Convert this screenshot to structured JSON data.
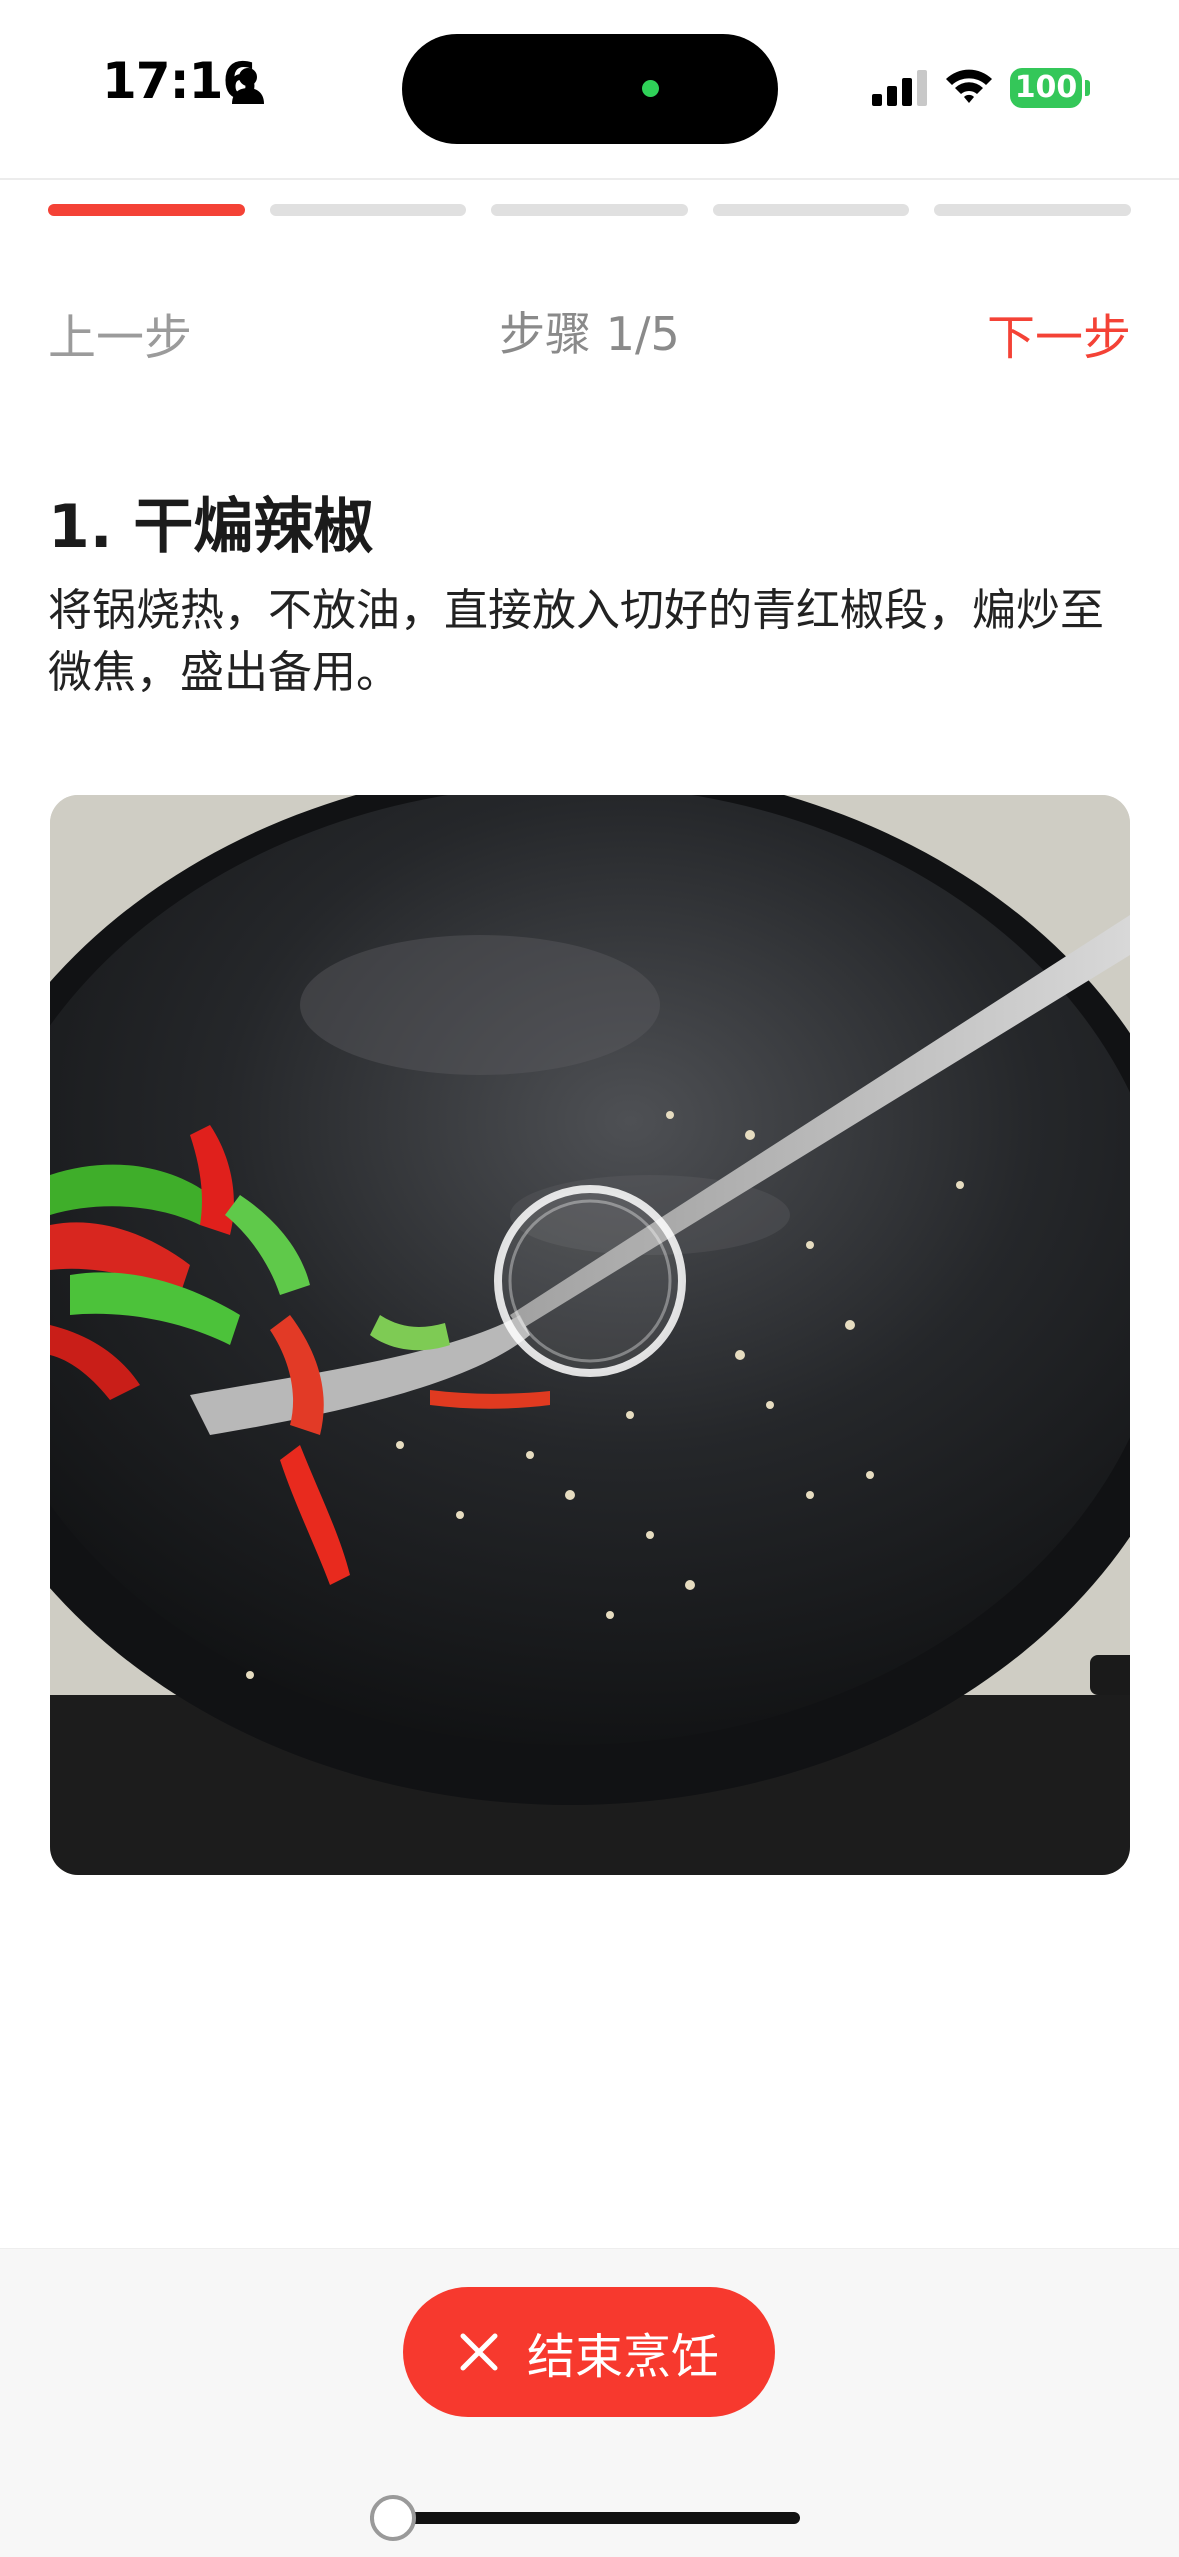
{
  "status_bar": {
    "time": "17:16",
    "battery": "100"
  },
  "progress": {
    "current": 1,
    "total": 5
  },
  "nav": {
    "prev_label": "上一步",
    "step_indicator": "步骤 1/5",
    "next_label": "下一步"
  },
  "step": {
    "title": "1. 干煸辣椒",
    "description": "将锅烧热，不放油，直接放入切好的青红椒段，煸炒至微焦，盛出备用。"
  },
  "actions": {
    "end_label": "结束烹饪"
  },
  "colors": {
    "accent": "#f44236",
    "button": "#f7392e",
    "inactive_segment": "#e0e0e0"
  },
  "icons": [
    "person-icon",
    "signal-icon",
    "wifi-icon",
    "close-icon",
    "play-icon"
  ]
}
